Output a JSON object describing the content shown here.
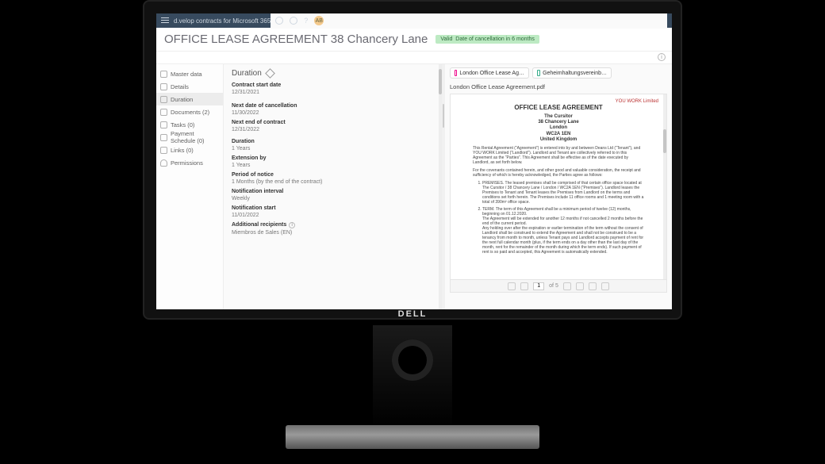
{
  "topbar": {
    "brand": "d.velop contracts for Microsoft 365",
    "avatar": "AB"
  },
  "header": {
    "title": "OFFICE LEASE AGREEMENT 38 Chancery Lane",
    "status_label": "Valid",
    "status_detail": "Date of cancellation in 6 months"
  },
  "nav": [
    {
      "icon": "master-data-icon",
      "label": "Master data"
    },
    {
      "icon": "details-icon",
      "label": "Details"
    },
    {
      "icon": "duration-icon",
      "label": "Duration",
      "active": true
    },
    {
      "icon": "documents-icon",
      "label": "Documents (2)"
    },
    {
      "icon": "tasks-icon",
      "label": "Tasks (0)"
    },
    {
      "icon": "payment-icon",
      "label": "Payment Schedule (0)"
    },
    {
      "icon": "links-icon",
      "label": "Links (0)"
    },
    {
      "icon": "permissions-icon",
      "label": "Permissions"
    }
  ],
  "panel": {
    "title": "Duration",
    "fields": [
      {
        "label": "Contract start date",
        "value": "12/31/2021"
      },
      {
        "label": "Next date of cancellation",
        "value": "11/30/2022"
      },
      {
        "label": "Next end of contract",
        "value": "12/31/2022"
      },
      {
        "label": "Duration",
        "value": "1 Years"
      },
      {
        "label": "Extension by",
        "value": "1 Years"
      },
      {
        "label": "Period of notice",
        "value": "1 Months (by the end of the contract)"
      },
      {
        "label": "Notification interval",
        "value": "Weekly"
      },
      {
        "label": "Notification start",
        "value": "11/01/2022"
      },
      {
        "label": "Additional recipients",
        "value": "Miembros de Sales (EN)",
        "info": true
      }
    ]
  },
  "doc_tabs": [
    {
      "label": "London Office Lease Ag…",
      "kind": "pdf"
    },
    {
      "label": "Geheimhaltungsvereinb…",
      "kind": "doc"
    }
  ],
  "doc_name": "London Office Lease Agreement.pdf",
  "pdf": {
    "logo": "YOU WORK Limited",
    "title": "OFFICE LEASE AGREEMENT",
    "addr1": "The Cursitor",
    "addr2": "38 Chancery Lane",
    "addr3": "London",
    "addr4": "WC2A 1EN",
    "addr5": "United Kingdom",
    "intro": "This Rental Agreement (“Agreement”) is entered into by and between Deans Ltd (“Tenant”), and YOU WORK Limited (“Landlord”). Landlord and Tenant are collectively referred to in this Agreement as the “Parties”. This Agreement shall be effective as of the date executed by Landlord, as set forth below.",
    "consid": "For the covenants contained herein, and other good and valuable consideration, the receipt and sufficiency of which is hereby acknowledged, the Parties agree as follows:",
    "li1": "PREMISES. The leased premises shall be comprised of that certain office space located at The Cursitor / 38 Chancery Lane / London / WC2A 1EN (“Premises”). Landlord leases the Premises to Tenant and Tenant leases the Premises from Landlord on the terms and conditions set forth herein. The Premises include 11 office rooms and 1 meeting room with a total of 390m² office space.",
    "li2a": "TERM. The term of this Agreement shall be a minimum period of twelve (12) months, beginning on 01.12.2020.",
    "li2b": "The Agreement will be extended for another 12 months if not cancelled 2 months before the end of the current period.",
    "li2c": "Any holding over after the expiration or earlier termination of the term without the consent of Landlord shall be construed to extend the Agreement and shall not be construed to be a tenancy from month to month, unless Tenant pays and Landlord accepts payment of rent for the next full calendar month (plus, if the term ends on a day other than the last day of the month, rent for the remainder of the month during which the term ends). If such payment of rent is so paid and accepted, this Agreement is automatically extended."
  },
  "pdf_ctrl": {
    "page": "1",
    "total": "of 5"
  }
}
